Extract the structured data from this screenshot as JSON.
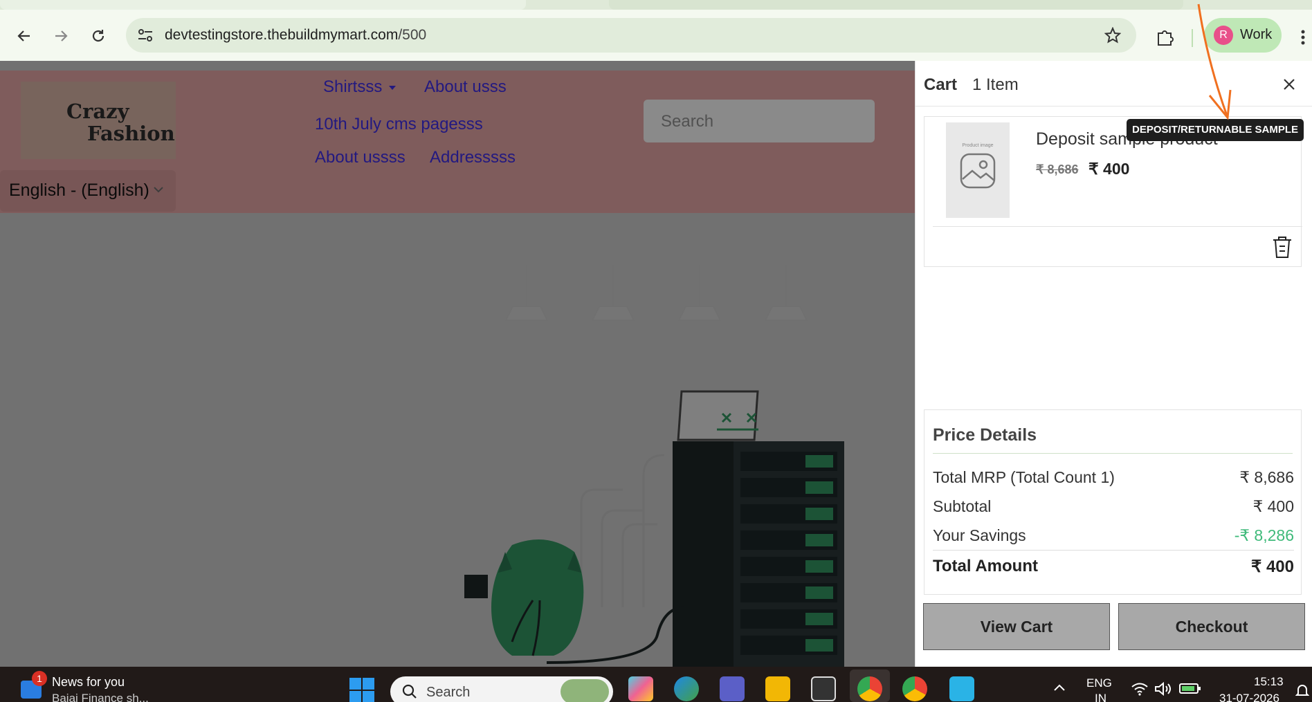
{
  "browser": {
    "url_host": "devtestingstore.thebuildmymart.com",
    "url_path": "/500",
    "profile_initial": "R",
    "profile_label": "Work"
  },
  "site": {
    "logo_line1": "Crazy",
    "logo_line2": "Fashion",
    "menu": [
      "Shirtsss",
      "About usss",
      "10th July cms pagesss",
      "About ussss",
      "Addresssss"
    ],
    "search_placeholder": "Search",
    "language": "English - (English)"
  },
  "cart": {
    "title": "Cart",
    "count_label": "1 Item",
    "item": {
      "thumb_caption": "Product image",
      "name": "Deposit sample product",
      "price_old": "₹ 8,686",
      "price_new": "₹ 400"
    },
    "tooltip": "DEPOSIT/RETURNABLE SAMPLE",
    "price_details": {
      "title": "Price Details",
      "rows": [
        {
          "label": "Total MRP (Total Count 1)",
          "value": "₹ 8,686"
        },
        {
          "label": "Subtotal",
          "value": "₹ 400"
        },
        {
          "label": "Your Savings",
          "value": "-₹ 8,286"
        },
        {
          "label": "Total Amount",
          "value": "₹ 400"
        }
      ]
    },
    "view_cart_label": "View Cart",
    "checkout_label": "Checkout"
  },
  "taskbar": {
    "news_badge": "1",
    "news_title": "News for you",
    "news_sub": "Bajaj Finance sh...",
    "search_label": "Search",
    "lang_line1": "ENG",
    "lang_line2": "IN",
    "time": "15:13",
    "date": "31-07-2026"
  },
  "colors": {
    "header_bg": "#d49a9a",
    "link": "#3b2bd6",
    "savings_green": "#3fba7a",
    "tooltip_bg": "#1e1e1e"
  }
}
